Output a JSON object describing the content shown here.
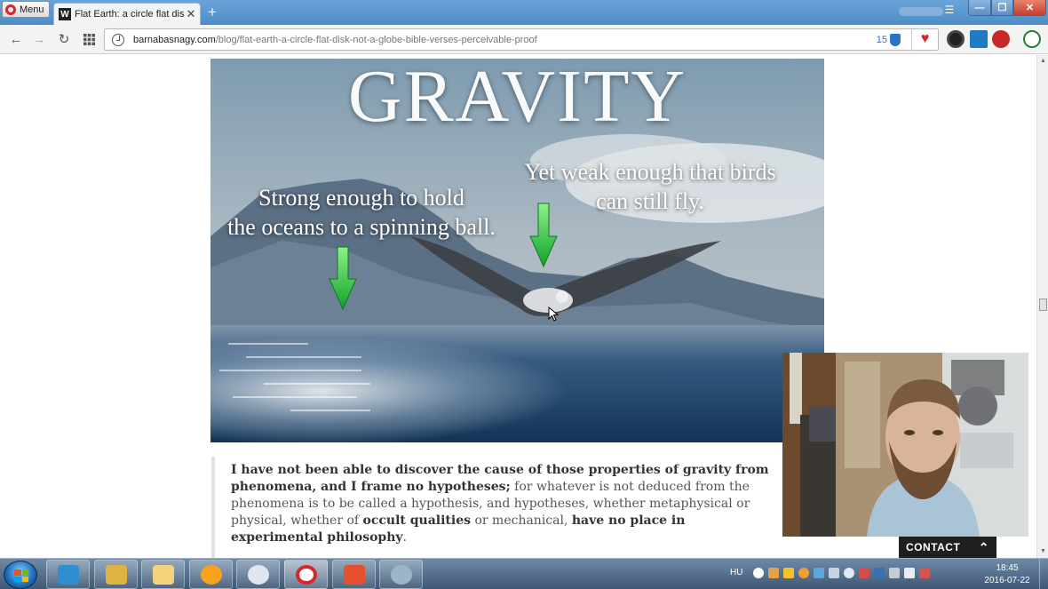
{
  "browser": {
    "menu_label": "Menu",
    "tab_title": "Flat Earth: a circle flat disk",
    "tab_favicon": "W",
    "url_host": "barnabasnagy.com",
    "url_path": "/blog/flat-earth-a-circle-flat-disk-not-a-globe-bible-verses-perceivable-proof",
    "badge_count": "15",
    "icons": [
      "back-icon",
      "forward-icon",
      "reload-icon",
      "speed-dial-icon",
      "shield-icon",
      "heart-icon"
    ]
  },
  "hero": {
    "title": "GRAVITY",
    "left_caption_line1": "Strong enough to hold",
    "left_caption_line2": "the oceans to a spinning ball.",
    "right_caption_line1": "Yet weak enough that birds",
    "right_caption_line2": "can still fly."
  },
  "quote": {
    "bold1": "I have not been able to discover the cause of those properties of gravity from phenomena, and I frame no hypotheses;",
    "text1": " for whatever is not deduced from the phenomena is to be called a hypothesis, and hypotheses, whether metaphysical or physical, whether of ",
    "bold2": "occult qualities",
    "text2": " or mechanical, ",
    "bold3": "have no place in experimental philosophy",
    "text3": "."
  },
  "contact": {
    "label": "CONTACT"
  },
  "taskbar": {
    "language": "HU",
    "time": "18:45",
    "date": "2016-07-22"
  },
  "colors": {
    "accent_blue": "#2b71c7",
    "opera_red": "#d8262b",
    "arrow_green": "#1fc23a",
    "contact_bg": "#1f1f1f"
  }
}
